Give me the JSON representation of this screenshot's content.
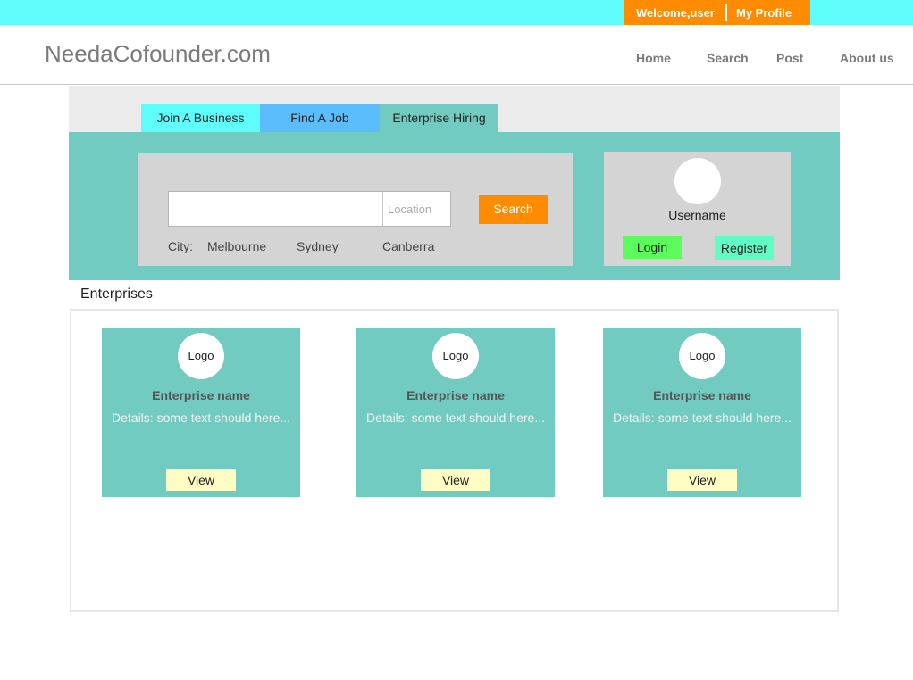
{
  "topbar": {
    "welcome": "Welcome,user",
    "profile": "My Profile"
  },
  "header": {
    "logo": "NeedaCofounder.com",
    "nav": [
      "Home",
      "Search",
      "Post",
      "About us"
    ]
  },
  "tabs": [
    "Join A Business",
    "Find A Job",
    "Enterprise Hiring"
  ],
  "search": {
    "placeholder": "",
    "location_placeholder": "Location",
    "button": "Search",
    "city_label": "City:",
    "cities": [
      "Melbourne",
      "Sydney",
      "Canberra"
    ]
  },
  "account": {
    "username": "Username",
    "login": "Login",
    "register": "Register"
  },
  "enterprises": {
    "title": "Enterprises",
    "cards": [
      {
        "logo": "Logo",
        "name": "Enterprise name",
        "details": "Details: some text should here...",
        "view": "View"
      },
      {
        "logo": "Logo",
        "name": "Enterprise name",
        "details": "Details: some text should here...",
        "view": "View"
      },
      {
        "logo": "Logo",
        "name": "Enterprise name",
        "details": "Details: some text should here...",
        "view": "View"
      }
    ]
  },
  "colors": {
    "topbar": "#5ffcfc",
    "accent_orange": "#ff8c00",
    "teal": "#72cbc1",
    "tab_blue": "#5cbdfc",
    "login_green": "#5dfc5d",
    "register_mint": "#5ffcc4",
    "view_yellow": "#fffcc4"
  }
}
